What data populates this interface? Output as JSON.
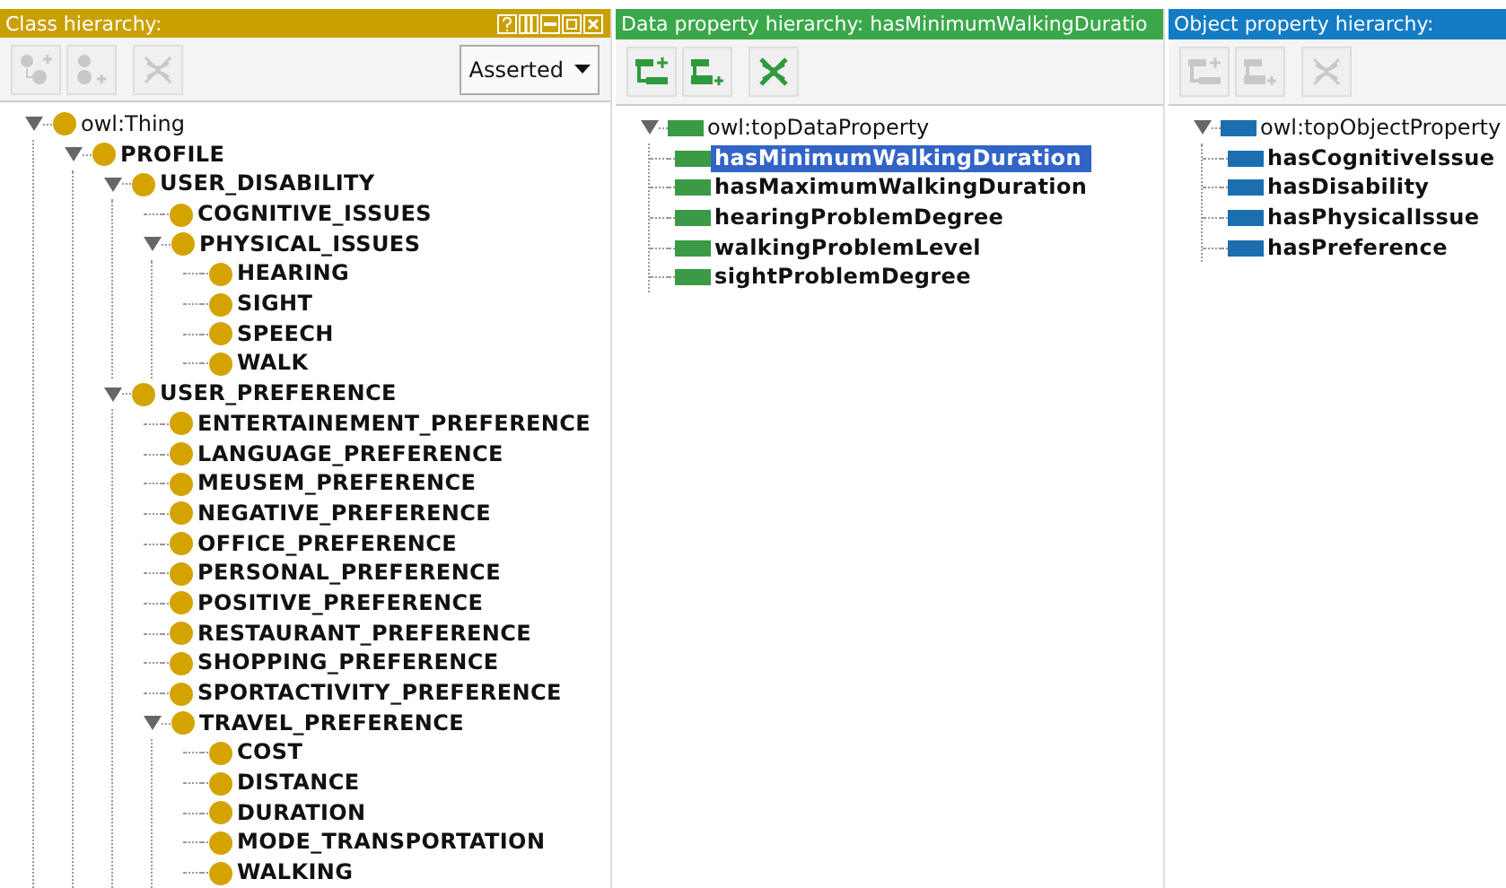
{
  "panels": [
    {
      "kind": "class",
      "title": "Class hierarchy:",
      "window_buttons": true,
      "dropdown": {
        "value": "Asserted"
      },
      "tree": [
        {
          "label": "owl:Thing",
          "expanded": true,
          "children": [
            {
              "label": "PROFILE",
              "expanded": true,
              "children": [
                {
                  "label": "USER_DISABILITY",
                  "expanded": true,
                  "children": [
                    {
                      "label": "COGNITIVE_ISSUES"
                    },
                    {
                      "label": "PHYSICAL_ISSUES",
                      "expanded": true,
                      "children": [
                        {
                          "label": "HEARING"
                        },
                        {
                          "label": "SIGHT"
                        },
                        {
                          "label": "SPEECH"
                        },
                        {
                          "label": "WALK"
                        }
                      ]
                    }
                  ]
                },
                {
                  "label": "USER_PREFERENCE",
                  "expanded": true,
                  "children": [
                    {
                      "label": "ENTERTAINEMENT_PREFERENCE"
                    },
                    {
                      "label": "LANGUAGE_PREFERENCE"
                    },
                    {
                      "label": "MEUSEM_PREFERENCE"
                    },
                    {
                      "label": "NEGATIVE_PREFERENCE"
                    },
                    {
                      "label": "OFFICE_PREFERENCE"
                    },
                    {
                      "label": "PERSONAL_PREFERENCE"
                    },
                    {
                      "label": "POSITIVE_PREFERENCE"
                    },
                    {
                      "label": "RESTAURANT_PREFERENCE"
                    },
                    {
                      "label": "SHOPPING_PREFERENCE"
                    },
                    {
                      "label": "SPORTACTIVITY_PREFERENCE"
                    },
                    {
                      "label": "TRAVEL_PREFERENCE",
                      "expanded": true,
                      "children": [
                        {
                          "label": "COST"
                        },
                        {
                          "label": "DISTANCE"
                        },
                        {
                          "label": "DURATION"
                        },
                        {
                          "label": "MODE_TRANSPORTATION"
                        },
                        {
                          "label": "WALKING"
                        }
                      ]
                    }
                  ]
                }
              ]
            }
          ]
        }
      ]
    },
    {
      "kind": "data",
      "title": "Data property hierarchy: hasMinimumWalkingDuratio",
      "tree": [
        {
          "label": "owl:topDataProperty",
          "expanded": true,
          "selected": false,
          "children": [
            {
              "label": "hasMinimumWalkingDuration",
              "selected": true
            },
            {
              "label": "hasMaximumWalkingDuration",
              "selected": false
            },
            {
              "label": "hearingProblemDegree",
              "selected": false
            },
            {
              "label": "walkingProblemLevel",
              "selected": false
            },
            {
              "label": "sightProblemDegree",
              "selected": false
            }
          ]
        }
      ]
    },
    {
      "kind": "object",
      "title": "Object property hierarchy:",
      "tree": [
        {
          "label": "owl:topObjectProperty",
          "expanded": true,
          "children": [
            {
              "label": "hasCognitiveIssue"
            },
            {
              "label": "hasDisability"
            },
            {
              "label": "hasPhysicalIssue"
            },
            {
              "label": "hasPreference"
            }
          ]
        }
      ]
    }
  ]
}
